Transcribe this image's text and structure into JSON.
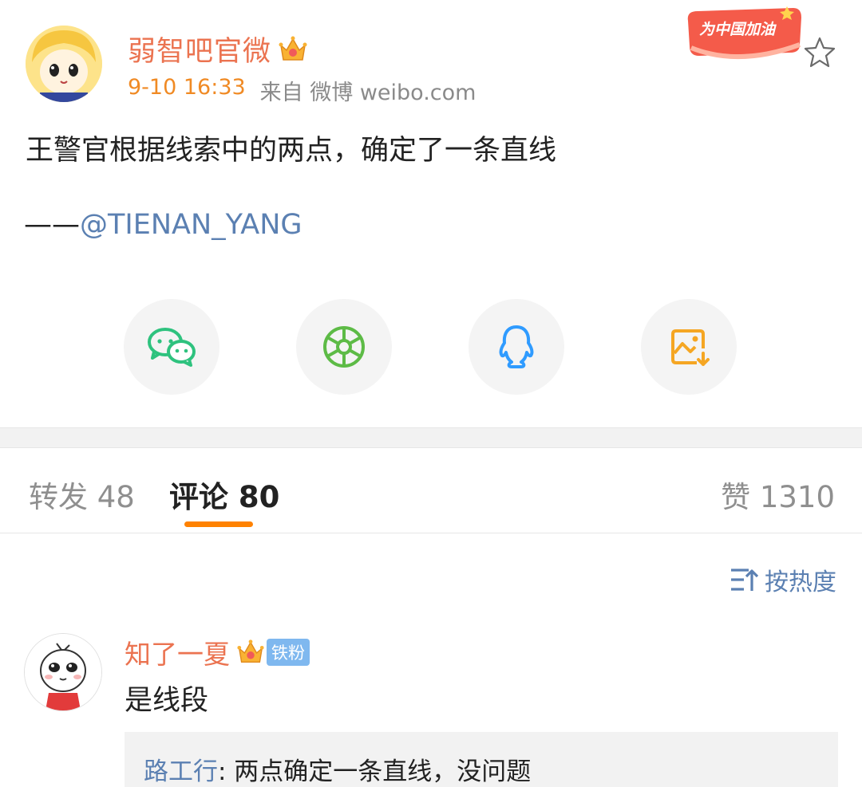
{
  "post": {
    "author": "弱智吧官微",
    "time": "9-10 16:33",
    "source": "来自 微博 weibo.com",
    "badge_text": "为中国加油",
    "text": "王警官根据线索中的两点，确定了一条直线",
    "quote_dash": "——",
    "mention": "@TIENAN_YANG"
  },
  "share": [
    {
      "icon": "wechat-icon",
      "color": "#2ec27e"
    },
    {
      "icon": "moments-icon",
      "color": "#5dbb46"
    },
    {
      "icon": "qq-icon",
      "color": "#2f9bff"
    },
    {
      "icon": "save-image-icon",
      "color": "#f5a623"
    }
  ],
  "tabs": {
    "repost": "转发 48",
    "comments": "评论 80",
    "likes": "赞 1310"
  },
  "sort": {
    "label": "按热度"
  },
  "comment": {
    "user": "知了一夏",
    "fan_badge": "铁粉",
    "text": "是线段",
    "reply_user": "路工行",
    "reply_text": ": 两点确定一条直线，没问题"
  }
}
